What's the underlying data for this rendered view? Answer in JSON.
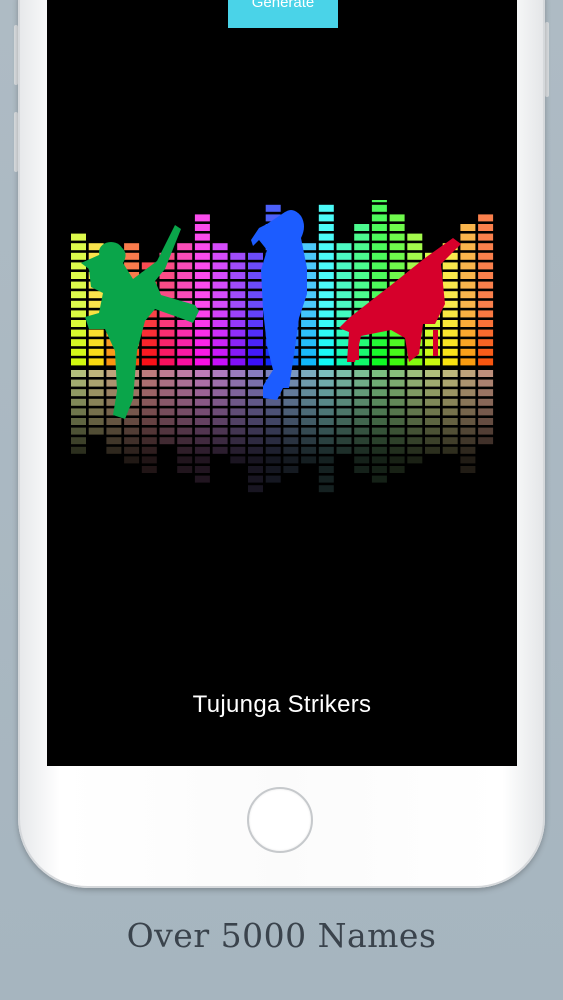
{
  "app": {
    "generate_label": "Generate",
    "band_name": "Tujunga Strikers",
    "caption": "Over 5000 Names"
  },
  "colors": {
    "accent": "#4ad3e8",
    "screen_bg": "#000000",
    "page_bg": "#a7b6c1",
    "guitarist": "#0aa54a",
    "singer": "#1c5cff",
    "pianist": "#d6002b"
  },
  "artwork": {
    "icons": [
      "guitarist-silhouette-icon",
      "singer-silhouette-icon",
      "pianist-silhouette-icon",
      "equalizer-graphic"
    ]
  }
}
